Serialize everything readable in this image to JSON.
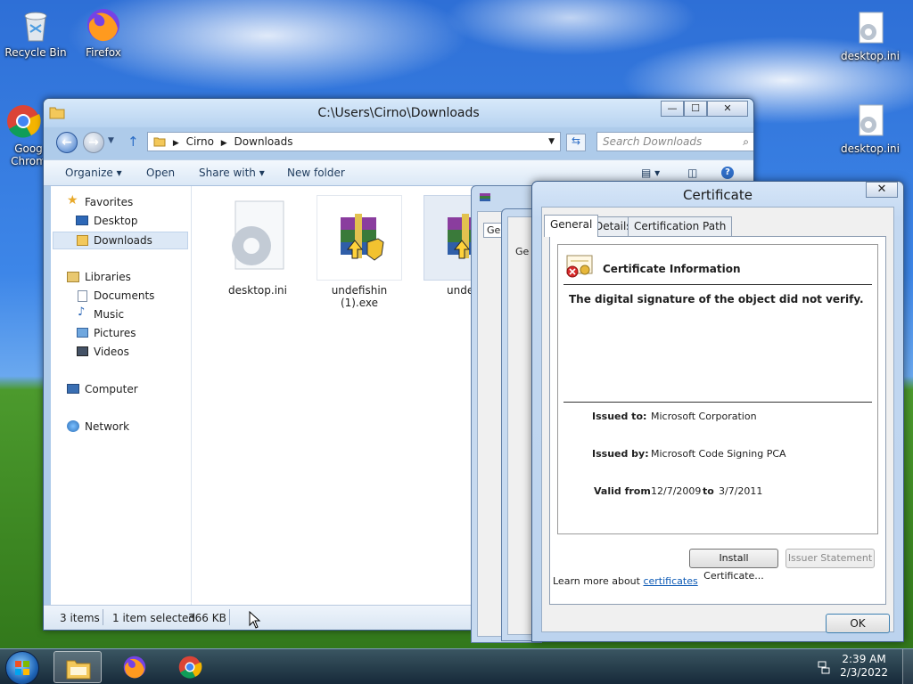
{
  "desktop": {
    "icons": [
      {
        "label": "Recycle Bin"
      },
      {
        "label": "Firefox"
      },
      {
        "label": "Goog Chrom"
      },
      {
        "label": "desktop.ini"
      },
      {
        "label": "desktop.ini"
      }
    ]
  },
  "explorer": {
    "title": "C:\\Users\\Cirno\\Downloads",
    "window_buttons": {
      "minimize": "—",
      "maximize": "☐",
      "close": "✕"
    },
    "breadcrumb": [
      "Cirno",
      "Downloads"
    ],
    "search_placeholder": "Search Downloads",
    "commands": {
      "organize": "Organize ▾",
      "open": "Open",
      "share": "Share with ▾",
      "new_folder": "New folder"
    },
    "nav": {
      "favorites": "Favorites",
      "desktop": "Desktop",
      "downloads": "Downloads",
      "libraries": "Libraries",
      "documents": "Documents",
      "music": "Music",
      "pictures": "Pictures",
      "videos": "Videos",
      "computer": "Computer",
      "network": "Network"
    },
    "files": [
      {
        "name": "desktop.ini"
      },
      {
        "name": "undefishin (1).exe"
      },
      {
        "name": "undefis"
      }
    ],
    "status": {
      "items": "3 items",
      "selected": "1 item selected",
      "size": "366 KB"
    }
  },
  "ghost_dialog_tabs": [
    "Gen",
    "Ge"
  ],
  "certificate": {
    "title": "Certificate",
    "close": "✕",
    "tabs": [
      "General",
      "Details",
      "Certification Path"
    ],
    "info_heading": "Certificate Information",
    "message": "The digital signature of the object did not verify.",
    "issued_to_label": "Issued to:",
    "issued_to": "Microsoft Corporation",
    "issued_by_label": "Issued by:",
    "issued_by": "Microsoft Code Signing PCA",
    "valid_from_label": "Valid from",
    "valid_from": "12/7/2009",
    "to_label": "to",
    "valid_to": "3/7/2011",
    "install_button": "Install Certificate...",
    "issuer_button": "Issuer Statement",
    "learn_more": "Learn more about",
    "learn_more_link": "certificates",
    "ok": "OK"
  },
  "taskbar": {
    "time": "2:39 AM",
    "date": "2/3/2022"
  }
}
